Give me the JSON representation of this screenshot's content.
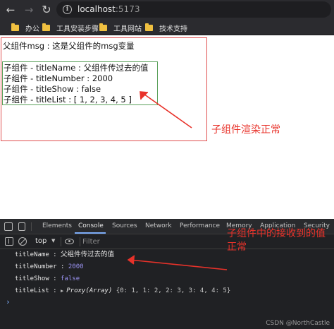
{
  "browser": {
    "url_host": "localhost",
    "url_port": ":5173",
    "bookmarks": [
      "办公",
      "工具安装步骤",
      "工具网站",
      "技术支持"
    ]
  },
  "page": {
    "parent_line": "父组件msg : 这是父组件的msg变量",
    "child_lines": [
      "子组件 - titleName : 父组件传过去的值",
      "子组件 - titleNumber : 2000",
      "子组件 - titleShow : false",
      "子组件 - titleList : [ 1, 2, 3, 4, 5 ]"
    ]
  },
  "annotations": {
    "render_note": "子组件渲染正常",
    "receive_note": "子组件中的接收到的值正常",
    "color": "#e8322a"
  },
  "devtools": {
    "tabs": [
      "Elements",
      "Console",
      "Sources",
      "Network",
      "Performance",
      "Memory",
      "Application",
      "Security"
    ],
    "active_tab": "Console",
    "context": "top",
    "filter_placeholder": "Filter",
    "logs": [
      {
        "key": "titleName :",
        "value": "父组件传过去的值",
        "kind": "string"
      },
      {
        "key": "titleNumber :",
        "value": "2000",
        "kind": "number"
      },
      {
        "key": "titleShow :",
        "value": "false",
        "kind": "boolean"
      },
      {
        "key": "titleList :",
        "value": "Proxy(Array)",
        "detail": "{0: 1, 1: 2, 2: 3, 3: 4, 4: 5}",
        "kind": "object"
      }
    ],
    "prompt": "›"
  },
  "watermark": "CSDN @NorthCastle"
}
